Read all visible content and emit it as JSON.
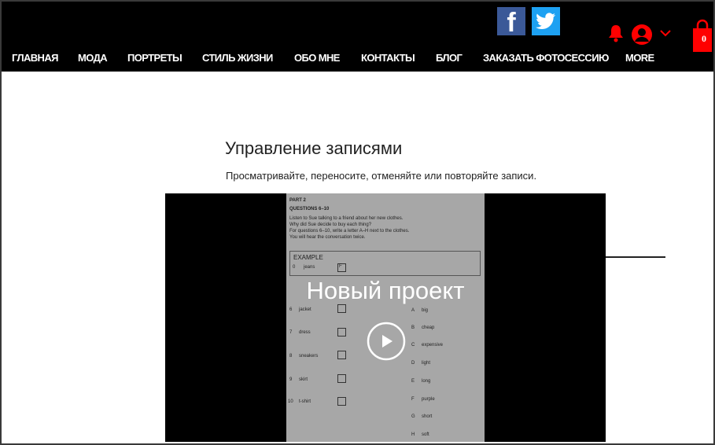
{
  "header": {
    "social": [
      {
        "name": "facebook-icon"
      },
      {
        "name": "twitter-icon"
      }
    ],
    "cart_count": "0",
    "icons": [
      "bell-icon",
      "user-icon",
      "chevron-down-icon",
      "shopping-bag-icon"
    ]
  },
  "nav": {
    "items": [
      "ГЛАВНАЯ",
      "МОДА",
      "ПОРТРЕТЫ",
      "СТИЛЬ ЖИЗНИ",
      "ОБО МНЕ",
      "КОНТАКТЫ",
      "БЛОГ",
      "ЗАКАЗАТЬ ФОТОСЕССИЮ",
      "MORE"
    ]
  },
  "main": {
    "title": "Управление записями",
    "subtitle": "Просматривайте, переносите, отменяйте или повторяйте записи."
  },
  "video": {
    "title": "Новый проект",
    "doc": {
      "part": "PART 2",
      "questions": "QUESTIONS 6–10",
      "lines": [
        "Listen to Sue talking to a friend about her new clothes.",
        "Why did Sue decide to buy each thing?",
        "For questions 6–10, write a letter A–H next to the clothes.",
        "You will hear the conversation twice."
      ],
      "example_label": "EXAMPLE",
      "example_num": "0",
      "example_word": "jeans",
      "example_answer": "F",
      "left_items": [
        {
          "num": "6",
          "word": "jacket"
        },
        {
          "num": "7",
          "word": "dress"
        },
        {
          "num": "8",
          "word": "sneakers"
        },
        {
          "num": "9",
          "word": "skirt"
        },
        {
          "num": "10",
          "word": "t-shirt"
        }
      ],
      "right_items": [
        {
          "letter": "A",
          "word": "big"
        },
        {
          "letter": "B",
          "word": "cheap"
        },
        {
          "letter": "C",
          "word": "expensive"
        },
        {
          "letter": "D",
          "word": "light"
        },
        {
          "letter": "E",
          "word": "long"
        },
        {
          "letter": "F",
          "word": "purple"
        },
        {
          "letter": "G",
          "word": "short"
        },
        {
          "letter": "H",
          "word": "soft"
        }
      ]
    }
  },
  "colors": {
    "header_bg": "#000000",
    "accent_red": "#ff0000",
    "facebook": "#3b5998",
    "twitter": "#1da1f2",
    "doc_bg": "#a7a7a7"
  }
}
